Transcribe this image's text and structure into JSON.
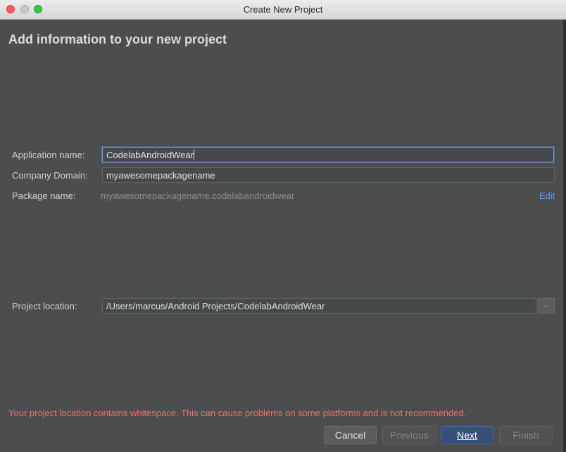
{
  "window": {
    "title": "Create New Project"
  },
  "heading": "Add information to your new project",
  "form": {
    "app_name_label": "Application name:",
    "app_name_value": "CodelabAndroidWear",
    "company_domain_label": "Company Domain:",
    "company_domain_value": "myawesomepackagename",
    "package_name_label": "Package name:",
    "package_name_value": "myawesomepackagename.codelabandroidwear",
    "edit_label": "Edit",
    "project_location_label": "Project location:",
    "project_location_value": "/Users/marcus/Android Projects/CodelabAndroidWear",
    "browse_label": "..."
  },
  "warning": "Your project location contains whitespace. This can cause problems on some platforms and is not recommended.",
  "buttons": {
    "cancel": "Cancel",
    "previous": "Previous",
    "next": "Next",
    "finish": "Finish"
  },
  "colors": {
    "background": "#4b4d4f",
    "warning": "#ff6b68",
    "link": "#589df6",
    "primary_button": "#36507a"
  }
}
